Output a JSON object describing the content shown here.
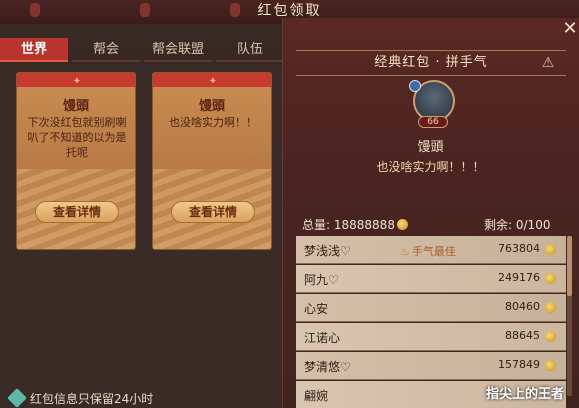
{
  "window": {
    "title": "红包领取"
  },
  "tabs": [
    {
      "label": "世界",
      "active": true
    },
    {
      "label": "帮会",
      "active": false
    },
    {
      "label": "帮会联盟",
      "active": false
    },
    {
      "label": "队伍",
      "active": false
    }
  ],
  "envelopes": [
    {
      "sender": "馒頭",
      "message": "下次没红包就别刷喇叭了不知道的以为是托呢",
      "button": "查看详情"
    },
    {
      "sender": "馒頭",
      "message": "也没啥实力啊！！",
      "button": "查看详情"
    }
  ],
  "footer": {
    "note": "红包信息只保留24小时"
  },
  "panel": {
    "header": "经典红包 · 拼手气",
    "sender": {
      "name": "馒頭",
      "level": "66",
      "message": "也没啥实力啊！！！"
    },
    "stats": {
      "total_label": "总量:",
      "total_value": "18888888",
      "remain_label": "剩余:",
      "remain_value": "0/100"
    },
    "badge_label": "手气最佳",
    "rows": [
      {
        "name": "梦浅浅♡",
        "amount": "763804",
        "best": true
      },
      {
        "name": "阿九♡",
        "amount": "249176",
        "best": false
      },
      {
        "name": "心安",
        "amount": "80460",
        "best": false
      },
      {
        "name": "江诺心",
        "amount": "88645",
        "best": false
      },
      {
        "name": "梦清悠♡",
        "amount": "157849",
        "best": false
      },
      {
        "name": "翩婉",
        "amount": "",
        "best": false
      }
    ],
    "close": "✕",
    "warn": "⚠"
  },
  "watermark": "指尖上的王者",
  "colors": {
    "accent": "#b8342c",
    "gold": "#f0c98a",
    "panel_bg": "#4a2421"
  }
}
